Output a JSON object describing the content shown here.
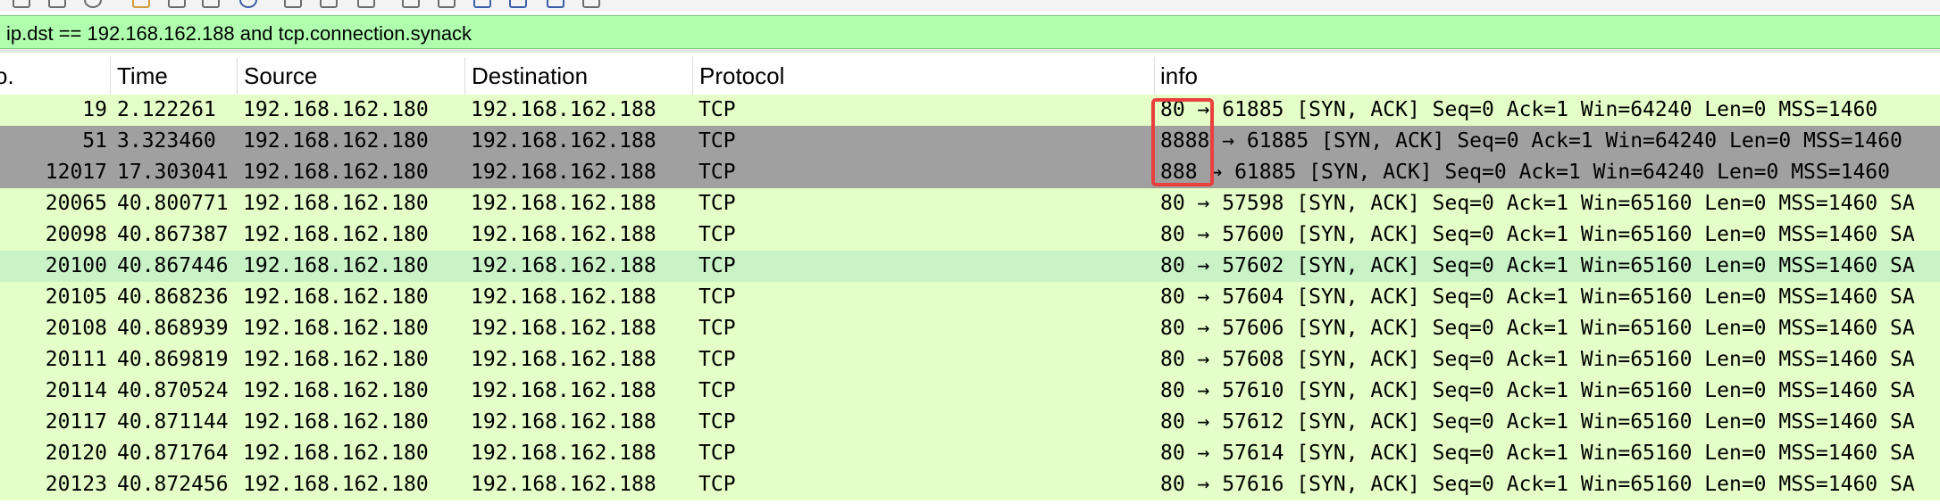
{
  "toolbar": {
    "icons": [
      "open-icon",
      "save-icon",
      "reload-icon",
      "close-file-icon",
      "find-icon",
      "back-icon",
      "forward-icon",
      "go-to-icon",
      "first-icon",
      "last-icon",
      "autoscroll-icon",
      "colorize-icon",
      "zoom-in-icon",
      "zoom-out-icon",
      "zoom-reset-icon",
      "resize-columns-icon"
    ]
  },
  "filter": {
    "value": "ip.dst == 192.168.162.188 and tcp.connection.synack",
    "background": "#afffaf"
  },
  "columns": {
    "no": "o.",
    "time": "Time",
    "source": "Source",
    "destination": "Destination",
    "protocol": "Protocol",
    "info": "info"
  },
  "colors": {
    "row_default": "#e4ffc7",
    "row_marked": "#a0a0a0",
    "row_selected_alt": "#c9f2c7",
    "highlight_box": "#e8403c"
  },
  "packets": [
    {
      "no": "19",
      "time": "2.122261",
      "source": "192.168.162.180",
      "destination": "192.168.162.188",
      "protocol": "TCP",
      "info": "80 → 61885 [SYN, ACK] Seq=0 Ack=1 Win=64240 Len=0 MSS=1460",
      "style": "default"
    },
    {
      "no": "51",
      "time": "3.323460",
      "source": "192.168.162.180",
      "destination": "192.168.162.188",
      "protocol": "TCP",
      "info": "8888 → 61885 [SYN, ACK] Seq=0 Ack=1 Win=64240 Len=0 MSS=1460",
      "style": "marked"
    },
    {
      "no": "12017",
      "time": "17.303041",
      "source": "192.168.162.180",
      "destination": "192.168.162.188",
      "protocol": "TCP",
      "info": "888 → 61885 [SYN, ACK] Seq=0 Ack=1 Win=64240 Len=0 MSS=1460",
      "style": "marked"
    },
    {
      "no": "20065",
      "time": "40.800771",
      "source": "192.168.162.180",
      "destination": "192.168.162.188",
      "protocol": "TCP",
      "info": "80 → 57598 [SYN, ACK] Seq=0 Ack=1 Win=65160 Len=0 MSS=1460 SA",
      "style": "default"
    },
    {
      "no": "20098",
      "time": "40.867387",
      "source": "192.168.162.180",
      "destination": "192.168.162.188",
      "protocol": "TCP",
      "info": "80 → 57600 [SYN, ACK] Seq=0 Ack=1 Win=65160 Len=0 MSS=1460 SA",
      "style": "default"
    },
    {
      "no": "20100",
      "time": "40.867446",
      "source": "192.168.162.180",
      "destination": "192.168.162.188",
      "protocol": "TCP",
      "info": "80 → 57602 [SYN, ACK] Seq=0 Ack=1 Win=65160 Len=0 MSS=1460 SA",
      "style": "alt"
    },
    {
      "no": "20105",
      "time": "40.868236",
      "source": "192.168.162.180",
      "destination": "192.168.162.188",
      "protocol": "TCP",
      "info": "80 → 57604 [SYN, ACK] Seq=0 Ack=1 Win=65160 Len=0 MSS=1460 SA",
      "style": "default"
    },
    {
      "no": "20108",
      "time": "40.868939",
      "source": "192.168.162.180",
      "destination": "192.168.162.188",
      "protocol": "TCP",
      "info": "80 → 57606 [SYN, ACK] Seq=0 Ack=1 Win=65160 Len=0 MSS=1460 SA",
      "style": "default"
    },
    {
      "no": "20111",
      "time": "40.869819",
      "source": "192.168.162.180",
      "destination": "192.168.162.188",
      "protocol": "TCP",
      "info": "80 → 57608 [SYN, ACK] Seq=0 Ack=1 Win=65160 Len=0 MSS=1460 SA",
      "style": "default"
    },
    {
      "no": "20114",
      "time": "40.870524",
      "source": "192.168.162.180",
      "destination": "192.168.162.188",
      "protocol": "TCP",
      "info": "80 → 57610 [SYN, ACK] Seq=0 Ack=1 Win=65160 Len=0 MSS=1460 SA",
      "style": "default"
    },
    {
      "no": "20117",
      "time": "40.871144",
      "source": "192.168.162.180",
      "destination": "192.168.162.188",
      "protocol": "TCP",
      "info": "80 → 57612 [SYN, ACK] Seq=0 Ack=1 Win=65160 Len=0 MSS=1460 SA",
      "style": "default"
    },
    {
      "no": "20120",
      "time": "40.871764",
      "source": "192.168.162.180",
      "destination": "192.168.162.188",
      "protocol": "TCP",
      "info": "80 → 57614 [SYN, ACK] Seq=0 Ack=1 Win=65160 Len=0 MSS=1460 SA",
      "style": "default"
    },
    {
      "no": "20123",
      "time": "40.872456",
      "source": "192.168.162.180",
      "destination": "192.168.162.188",
      "protocol": "TCP",
      "info": "80 → 57616 [SYN, ACK] Seq=0 Ack=1 Win=65160 Len=0 MSS=1460 SA",
      "style": "default"
    }
  ]
}
